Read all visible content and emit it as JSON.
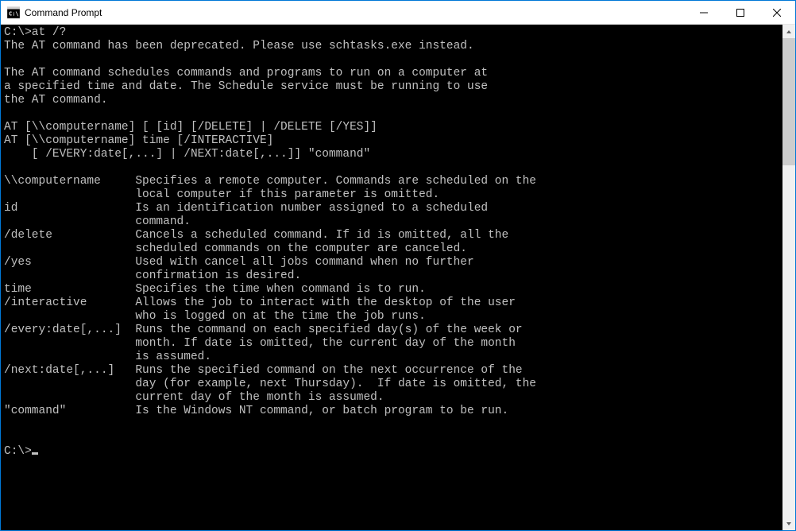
{
  "window": {
    "title": "Command Prompt"
  },
  "terminal": {
    "prompt1": "C:\\>at /?",
    "line_deprecated": "The AT command has been deprecated. Please use schtasks.exe instead.",
    "blank": "",
    "desc1": "The AT command schedules commands and programs to run on a computer at",
    "desc2": "a specified time and date. The Schedule service must be running to use",
    "desc3": "the AT command.",
    "syntax1": "AT [\\\\computername] [ [id] [/DELETE] | /DELETE [/YES]]",
    "syntax2": "AT [\\\\computername] time [/INTERACTIVE]",
    "syntax3": "    [ /EVERY:date[,...] | /NEXT:date[,...]] \"command\"",
    "param_computername1": "\\\\computername     Specifies a remote computer. Commands are scheduled on the",
    "param_computername2": "                   local computer if this parameter is omitted.",
    "param_id1": "id                 Is an identification number assigned to a scheduled",
    "param_id2": "                   command.",
    "param_delete1": "/delete            Cancels a scheduled command. If id is omitted, all the",
    "param_delete2": "                   scheduled commands on the computer are canceled.",
    "param_yes1": "/yes               Used with cancel all jobs command when no further",
    "param_yes2": "                   confirmation is desired.",
    "param_time": "time               Specifies the time when command is to run.",
    "param_interactive1": "/interactive       Allows the job to interact with the desktop of the user",
    "param_interactive2": "                   who is logged on at the time the job runs.",
    "param_every1": "/every:date[,...]  Runs the command on each specified day(s) of the week or",
    "param_every2": "                   month. If date is omitted, the current day of the month",
    "param_every3": "                   is assumed.",
    "param_next1": "/next:date[,...]   Runs the specified command on the next occurrence of the",
    "param_next2": "                   day (for example, next Thursday).  If date is omitted, the",
    "param_next3": "                   current day of the month is assumed.",
    "param_command": "\"command\"          Is the Windows NT command, or batch program to be run.",
    "prompt2": "C:\\>"
  }
}
